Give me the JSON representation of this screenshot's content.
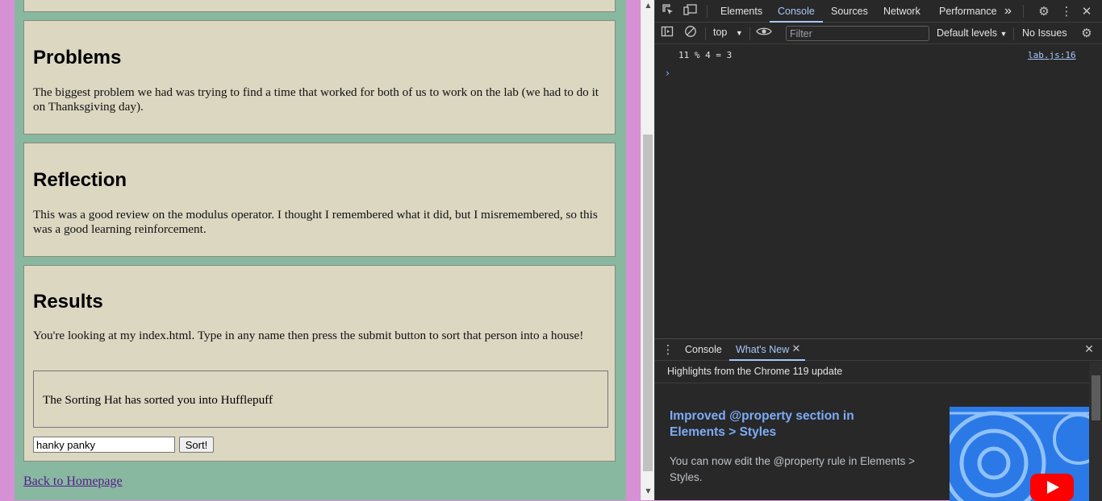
{
  "page": {
    "sections": {
      "problems": {
        "heading": "Problems",
        "text": "The biggest problem we had was trying to find a time that worked for both of us to work on the lab (we had to do it on Thanksgiving day)."
      },
      "reflection": {
        "heading": "Reflection",
        "text": "This was a good review on the modulus operator. I thought I remembered what it did, but I misremembered, so this was a good learning reinforcement."
      },
      "results": {
        "heading": "Results",
        "text": "You're looking at my index.html. Type in any name then press the submit button to sort that person into a house!",
        "output": "The Sorting Hat has sorted you into Hufflepuff",
        "input_value": "hanky panky",
        "button_label": "Sort!"
      }
    },
    "back_link": "Back to Homepage"
  },
  "devtools": {
    "tabs": [
      "Elements",
      "Console",
      "Sources",
      "Network",
      "Performance"
    ],
    "active_tab": "Console",
    "more_tabs": "»",
    "toolbar": {
      "context": "top",
      "filter_placeholder": "Filter",
      "levels": "Default levels",
      "issues": "No Issues"
    },
    "console": {
      "log_text": "11 % 4 = 3",
      "log_source": "lab.js:16",
      "prompt": "›"
    },
    "drawer": {
      "tabs": [
        "Console",
        "What's New"
      ],
      "active_tab": "What's New",
      "heading": "Highlights from the Chrome 119 update",
      "feature_title": "Improved @property section in Elements > Styles",
      "feature_desc": "You can now edit the @property rule in Elements > Styles."
    }
  },
  "colors": {
    "page_bg": "#d690d4",
    "main_bg": "#88b8a0",
    "section_bg": "#dbd7c1",
    "devtools_bg": "#282828",
    "accent": "#a8c7fa"
  }
}
